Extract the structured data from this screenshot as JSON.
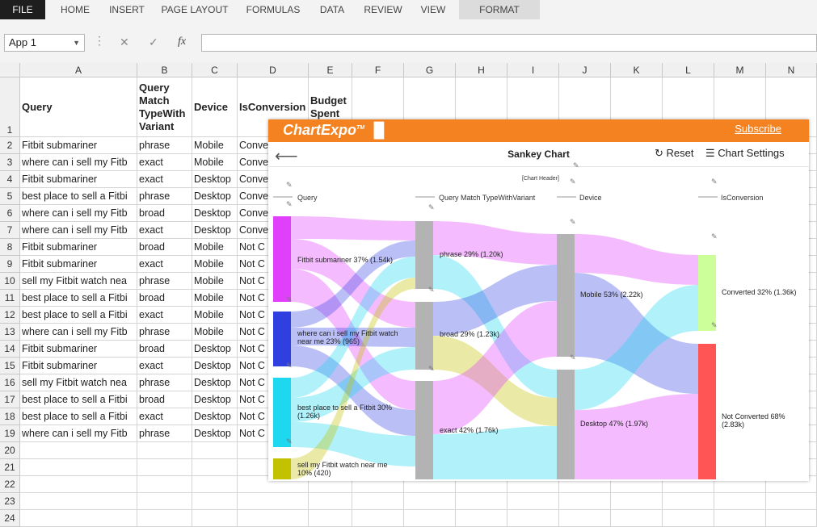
{
  "ribbon": {
    "tabs": [
      "FILE",
      "HOME",
      "INSERT",
      "PAGE LAYOUT",
      "FORMULAS",
      "DATA",
      "REVIEW",
      "VIEW",
      "FORMAT"
    ]
  },
  "formula_bar": {
    "name_box": "App 1",
    "cancel_icon": "✕",
    "enter_icon": "✓",
    "fx_icon": "fx",
    "value": ""
  },
  "sheet": {
    "columns": [
      "A",
      "B",
      "C",
      "D",
      "E",
      "F",
      "G",
      "H",
      "I",
      "J",
      "K",
      "L",
      "M",
      "N"
    ],
    "header_row": [
      "Query",
      "Query Match TypeWith Variant",
      "Device",
      "IsConversion",
      "Budget Spent"
    ],
    "rows": [
      [
        "Fitbit submariner",
        "phrase",
        "Mobile",
        "Conve"
      ],
      [
        "where can i sell my Fitb",
        "exact",
        "Mobile",
        "Conve"
      ],
      [
        "Fitbit submariner",
        "exact",
        "Desktop",
        "Conve"
      ],
      [
        "best place to sell a Fitbi",
        "phrase",
        "Desktop",
        "Conve"
      ],
      [
        "where can i sell my Fitb",
        "broad",
        "Desktop",
        "Conve"
      ],
      [
        "where can i sell my Fitb",
        "exact",
        "Desktop",
        "Conve"
      ],
      [
        "Fitbit submariner",
        "broad",
        "Mobile",
        "Not C"
      ],
      [
        "Fitbit submariner",
        "exact",
        "Mobile",
        "Not C"
      ],
      [
        "sell my Fitbit watch nea",
        "phrase",
        "Mobile",
        "Not C"
      ],
      [
        "best place to sell a Fitbi",
        "broad",
        "Mobile",
        "Not C"
      ],
      [
        "best place to sell a Fitbi",
        "exact",
        "Mobile",
        "Not C"
      ],
      [
        "where can i sell my Fitb",
        "phrase",
        "Mobile",
        "Not C"
      ],
      [
        "Fitbit submariner",
        "broad",
        "Desktop",
        "Not C"
      ],
      [
        "Fitbit submariner",
        "exact",
        "Desktop",
        "Not C"
      ],
      [
        "sell my Fitbit watch nea",
        "phrase",
        "Desktop",
        "Not C"
      ],
      [
        "best place to sell a Fitbi",
        "broad",
        "Desktop",
        "Not C"
      ],
      [
        "best place to sell a Fitbi",
        "exact",
        "Desktop",
        "Not C"
      ],
      [
        "where can i sell my Fitb",
        "phrase",
        "Desktop",
        "Not C"
      ]
    ],
    "row_numbers": [
      "1",
      "2",
      "3",
      "4",
      "5",
      "6",
      "7",
      "8",
      "9",
      "10",
      "11",
      "12",
      "13",
      "14",
      "15",
      "16",
      "17",
      "18",
      "19",
      "20",
      "21",
      "22",
      "23",
      "24"
    ]
  },
  "chart_window": {
    "logo": "ChartExpo",
    "logo_tm": "TM",
    "subscribe": "Subscribe",
    "title": "Sankey Chart",
    "reset": "Reset",
    "settings": "Chart Settings",
    "chart_header_placeholder": "[Chart Header]"
  },
  "chart_data": {
    "type": "sankey",
    "levels": [
      "Query",
      "Query Match TypeWithVariant",
      "Device",
      "IsConversion"
    ],
    "nodes": [
      {
        "level": 0,
        "name": "Fitbit submariner",
        "pct": "37%",
        "value": "(1.54k)",
        "color": "#e040fb"
      },
      {
        "level": 0,
        "name": "where can i sell my Fitbit watch near me",
        "pct": "23%",
        "value": "(965)",
        "color": "#2f3fe0"
      },
      {
        "level": 0,
        "name": "best place to sell a Fitbit",
        "pct": "30%",
        "value": "(1.26k)",
        "color": "#1ed8f0"
      },
      {
        "level": 0,
        "name": "sell my Fitbit watch near me",
        "pct": "10%",
        "value": "(420)",
        "color": "#c3c200"
      },
      {
        "level": 1,
        "name": "phrase",
        "pct": "29%",
        "value": "(1.20k)",
        "color": "#b3b3b3"
      },
      {
        "level": 1,
        "name": "broad",
        "pct": "29%",
        "value": "(1.23k)",
        "color": "#b3b3b3"
      },
      {
        "level": 1,
        "name": "exact",
        "pct": "42%",
        "value": "(1.76k)",
        "color": "#b3b3b3"
      },
      {
        "level": 2,
        "name": "Mobile",
        "pct": "53%",
        "value": "(2.22k)",
        "color": "#b3b3b3"
      },
      {
        "level": 2,
        "name": "Desktop",
        "pct": "47%",
        "value": "(1.97k)",
        "color": "#b3b3b3"
      },
      {
        "level": 3,
        "name": "Converted",
        "pct": "32%",
        "value": "(1.36k)",
        "color": "#ccff99"
      },
      {
        "level": 3,
        "name": "Not Converted",
        "pct": "68%",
        "value": "(2.83k)",
        "color": "#ff5555"
      }
    ]
  },
  "labels": {
    "n0": "Fitbit submariner 37% (1.54k)",
    "n1a": "where can i sell my Fitbit watch",
    "n1b": "near me 23% (965)",
    "n2a": "best place to sell a Fitbit 30%",
    "n2b": "(1.26k)",
    "n3a": "sell my Fitbit watch near me",
    "n3b": "10% (420)",
    "n4": "phrase 29% (1.20k)",
    "n5": "broad 29% (1.23k)",
    "n6": "exact 42% (1.76k)",
    "n7": "Mobile 53% (2.22k)",
    "n8": "Desktop 47% (1.97k)",
    "n9": "Converted 32% (1.36k)",
    "n10a": "Not Converted 68%",
    "n10b": "(2.83k)"
  }
}
